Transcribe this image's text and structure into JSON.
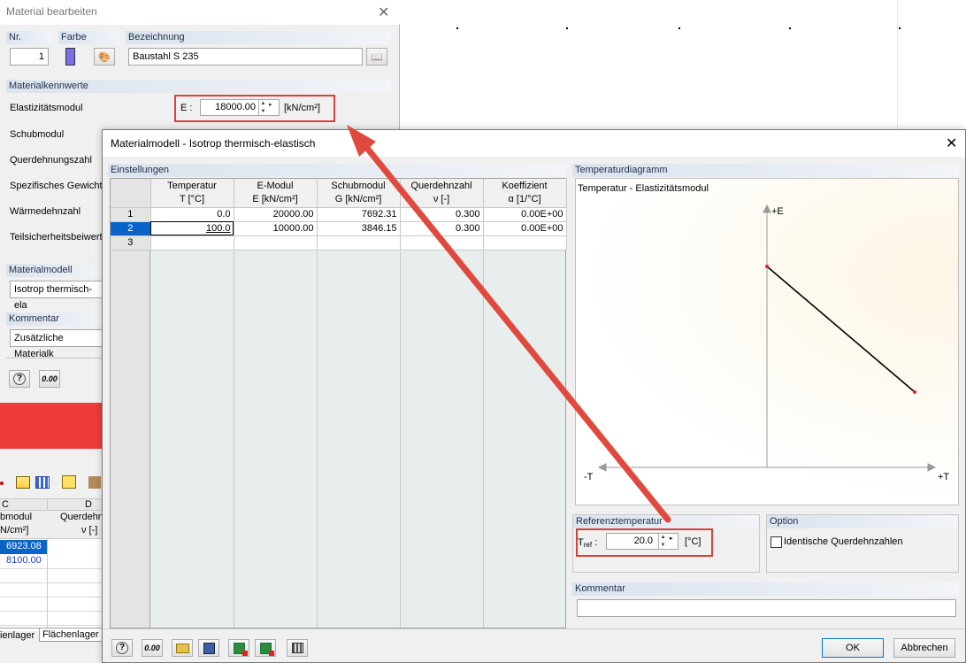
{
  "background_dialog": {
    "title": "Material bearbeiten",
    "nr_label": "Nr.",
    "nr_value": "1",
    "farbe_label": "Farbe",
    "bezeichnung_label": "Bezeichnung",
    "bezeichnung_value": "Baustahl S 235",
    "materialkennwerte_header": "Materialkennwerte",
    "props": [
      "Elastizitätsmodul",
      "Schubmodul",
      "Querdehnungszahl",
      "Spezifisches Gewicht",
      "Wärmedehnzahl",
      "Teilsicherheitsbeiwert"
    ],
    "e_label": "E :",
    "e_value": "18000.00",
    "e_unit": "[kN/cm²]",
    "materialmodell_header": "Materialmodell",
    "materialmodell_value": "Isotrop thermisch-ela",
    "kommentar_header": "Kommentar",
    "kommentar_value": "Zusätzliche Materialk",
    "zero_button": "0.00"
  },
  "background_table": {
    "col_c_letter": "C",
    "col_d_letter": "D",
    "col_c_header1": "bmodul",
    "col_c_header2": "N/cm²]",
    "col_d_header1": "Querdehn",
    "col_d_header2": "ν [-]",
    "rows": [
      "6923.08",
      "8100.00"
    ],
    "tab1": "ienlager",
    "tab2": "Flächenlager"
  },
  "dialog": {
    "title": "Materialmodell - Isotrop thermisch-elastisch",
    "einstellungen_header": "Einstellungen",
    "columns": [
      {
        "h1": "Temperatur",
        "h2": "T [°C]"
      },
      {
        "h1": "E-Modul",
        "h2": "E [kN/cm²]"
      },
      {
        "h1": "Schubmodul",
        "h2": "G [kN/cm²]"
      },
      {
        "h1": "Querdehnzahl",
        "h2": "ν [-]"
      },
      {
        "h1": "Koeffizient",
        "h2": "α [1/°C]"
      }
    ],
    "rows": [
      {
        "n": "1",
        "t": "0.0",
        "e": "20000.00",
        "g": "7692.31",
        "v": "0.300",
        "a": "0.00E+00"
      },
      {
        "n": "2",
        "t": "100.0",
        "e": "10000.00",
        "g": "3846.15",
        "v": "0.300",
        "a": "0.00E+00"
      },
      {
        "n": "3",
        "t": "",
        "e": "",
        "g": "",
        "v": "",
        "a": ""
      }
    ],
    "temperaturdiagramm_header": "Temperaturdiagramm",
    "diagram_title": "Temperatur - Elastizitätsmodul",
    "axis_pos_e": "+E",
    "axis_neg_t": "-T",
    "axis_pos_t": "+T",
    "referenztemperatur_header": "Referenztemperatur",
    "tref_label": "T",
    "tref_sub": "ref",
    "tref_colon": ":",
    "tref_value": "20.0",
    "tref_unit": "[°C]",
    "option_header": "Option",
    "option_checkbox_label": "Identische Querdehnzahlen",
    "option_checked": false,
    "kommentar_header": "Kommentar",
    "kommentar_value": "",
    "ok_button": "OK",
    "cancel_button": "Abbrechen",
    "zero_button": "0.00"
  },
  "chart_data": {
    "type": "line",
    "title": "Temperatur - Elastizitätsmodul",
    "x": [
      0,
      100
    ],
    "series": [
      {
        "values": [
          20000,
          10000
        ]
      }
    ],
    "xlabel": "+T",
    "ylabel": "+E"
  },
  "colors": {
    "highlight": "#d9403a",
    "selection": "#0a64c8",
    "point": "#e02020"
  }
}
